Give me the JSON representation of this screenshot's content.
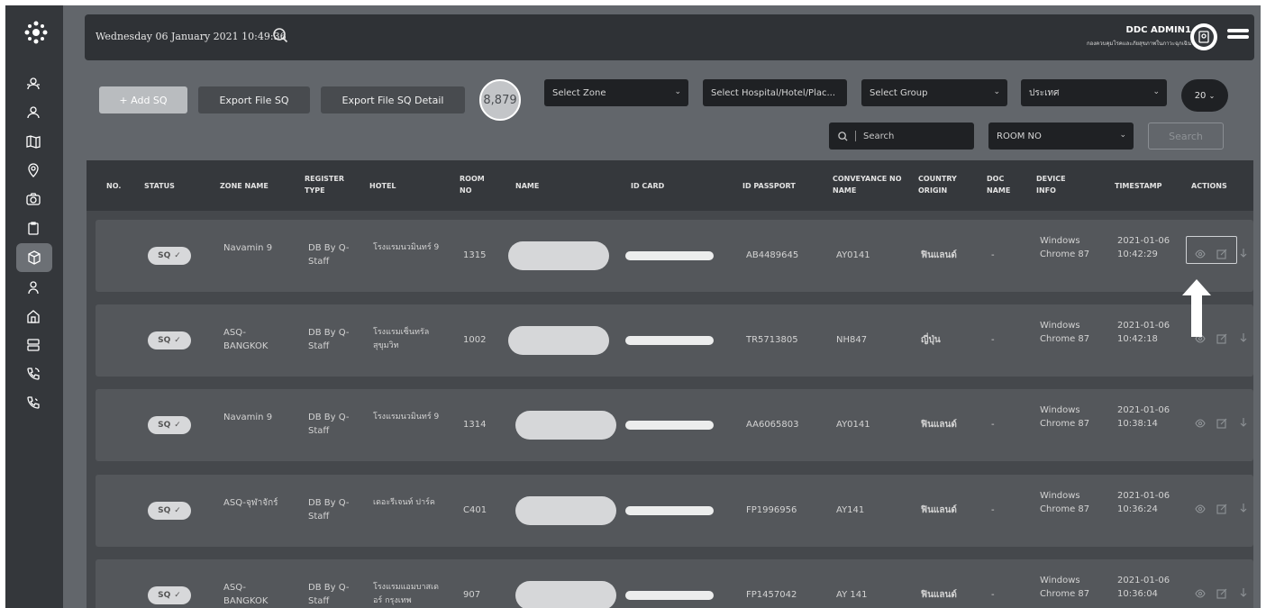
{
  "header": {
    "datetime": "Wednesday 06 January 2021 10:49:36",
    "admin_name": "DDC ADMIN1",
    "admin_org": "กองควบคุมโรคและภัยสุขภาพในภาวะฉุกเฉิน"
  },
  "toolbar": {
    "add_label": "+ Add SQ",
    "export_label": "Export File SQ",
    "export_detail_label": "Export File SQ Detail",
    "total_count": "8,879",
    "select_zone": "Select Zone",
    "select_hospital": "Select Hospital/Hotel/Plac...",
    "select_group": "Select Group",
    "select_country": "ประเทศ",
    "page_size": "20",
    "search_placeholder": "Search",
    "room_no": "ROOM NO",
    "search_button": "Search"
  },
  "table": {
    "headers": {
      "no": "NO.",
      "status": "STATUS",
      "zone": "ZONE NAME",
      "register": "REGISTER TYPE",
      "hotel": "HOTEL",
      "room": "ROOM NO",
      "name": "NAME",
      "idcard": "ID CARD",
      "passport": "ID PASSPORT",
      "conveyance": "CONVEYANCE NO NAME",
      "country": "COUNTRY ORIGIN",
      "doc": "DOC NAME",
      "device": "DEVICE INFO",
      "timestamp": "TIMESTAMP",
      "actions": "ACTIONS"
    },
    "rows": [
      {
        "status": "SQ",
        "zone": "Navamin 9",
        "register": "DB By Q-Staff",
        "hotel": "โรงแรมนวมินทร์ 9",
        "room": "1315",
        "passport": "AB4489645",
        "conveyance": "AY0141",
        "country": "ฟินแลนด์",
        "doc": "-",
        "device": "Windows Chrome 87",
        "timestamp": "2021-01-06 10:42:29"
      },
      {
        "status": "SQ",
        "zone": "ASQ-BANGKOK",
        "register": "DB By Q-Staff",
        "hotel": "โรงแรมเซ็นทรัลสุขุมวิท",
        "room": "1002",
        "passport": "TR5713805",
        "conveyance": "NH847",
        "country": "ญี่ปุ่น",
        "doc": "-",
        "device": "Windows Chrome 87",
        "timestamp": "2021-01-06 10:42:18"
      },
      {
        "status": "SQ",
        "zone": "Navamin 9",
        "register": "DB By Q-Staff",
        "hotel": "โรงแรมนวมินทร์ 9",
        "room": "1314",
        "passport": "AA6065803",
        "conveyance": "AY0141",
        "country": "ฟินแลนด์",
        "doc": "-",
        "device": "Windows Chrome 87",
        "timestamp": "2021-01-06 10:38:14"
      },
      {
        "status": "SQ",
        "zone": "ASQ-จุฬาจักร์",
        "register": "DB By Q-Staff",
        "hotel": "เดอะรีเจนท์ ปาร์ค",
        "room": "C401",
        "passport": "FP1996956",
        "conveyance": "AY141",
        "country": "ฟินแลนด์",
        "doc": "-",
        "device": "Windows Chrome 87",
        "timestamp": "2021-01-06 10:36:24"
      },
      {
        "status": "SQ",
        "zone": "ASQ-BANGKOK",
        "register": "DB By Q-Staff",
        "hotel": "โรงแรมแอมบาสเดอร์ กรุงเทพ",
        "room": "907",
        "passport": "FP1457042",
        "conveyance": "AY 141",
        "country": "ฟินแลนด์",
        "doc": "-",
        "device": "Windows Chrome 87",
        "timestamp": "2021-01-06 10:36:04"
      }
    ]
  },
  "icons": {
    "sidebar": [
      "users-icon",
      "user-group-icon",
      "map-icon",
      "location-pin-icon",
      "camera-icon",
      "clipboard-icon",
      "box-icon",
      "person-icon",
      "home-icon",
      "database-icon",
      "phone-icon",
      "phone-call-icon"
    ],
    "actions": [
      "eye-icon",
      "edit-icon",
      "download-icon"
    ]
  },
  "colors": {
    "background": "#62666b",
    "sidebar": "#34373b",
    "header": "#2f3236",
    "row": "#54575b",
    "badge": "#d7d8da"
  }
}
